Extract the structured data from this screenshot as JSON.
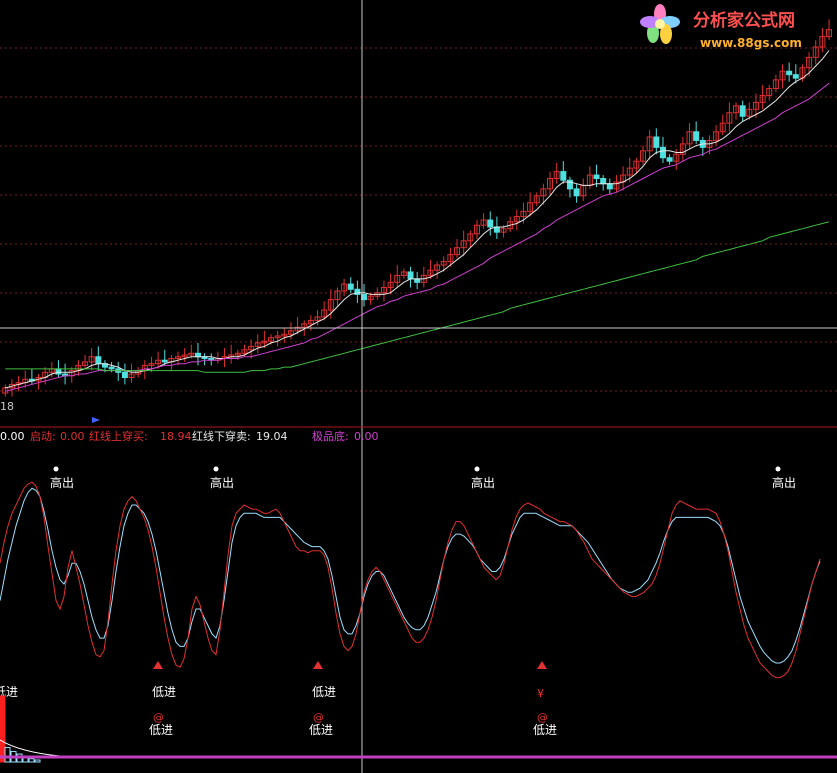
{
  "watermark": {
    "site_name": "分析家公式网",
    "site_url": "www.88gs.com",
    "logo_icon": "flower-logo-icon"
  },
  "colors": {
    "background": "#000000",
    "grid": "#7a1f1f",
    "divider": "#b01818",
    "candle_up": "#e03030",
    "candle_down": "#4fe0e0",
    "ma_white": "#e8e8e8",
    "ma_magenta": "#d040d0",
    "ma_green": "#40c040",
    "crosshair": "#c8c8c8",
    "osc_red": "#e03030",
    "osc_cyan": "#9be0ff",
    "label_white": "#ffffff",
    "label_red": "#e03030",
    "bar_red": "#ff2020",
    "bottom_line": "#c040c0",
    "status_start": "#e03030",
    "status_cross_up": "#e03030",
    "status_cross_down": "#e8e8e8",
    "status_bottom": "#d040d0"
  },
  "price_panel": {
    "corner_label": "18",
    "marker_icon": "arrow-right-icon"
  },
  "status_bar": {
    "lead_value": "0.00",
    "items": [
      {
        "label": "启动:",
        "value": "0.00"
      },
      {
        "label": "红线上穿买:",
        "value": "18.94"
      },
      {
        "label": "红线下穿卖:",
        "value": "19.04"
      },
      {
        "label": "极品底:",
        "value": "0.00"
      }
    ]
  },
  "signals": {
    "high_label": "高出",
    "low_label": "低进",
    "at_symbol": "@",
    "yen_symbol": "¥"
  },
  "chart_data": {
    "type": "line",
    "candles": {
      "x": [
        1,
        2,
        3,
        4,
        5,
        6,
        7,
        8,
        9,
        10,
        11,
        12,
        13,
        14,
        15,
        16,
        17,
        18,
        19,
        20,
        21,
        22,
        23,
        24,
        25,
        26,
        27,
        28,
        29,
        30,
        31,
        32,
        33,
        34,
        35,
        36,
        37,
        38,
        39,
        40,
        41,
        42,
        43,
        44,
        45,
        46,
        47,
        48,
        49,
        50,
        51,
        52,
        53,
        54,
        55,
        56,
        57,
        58,
        59,
        60,
        61,
        62,
        63,
        64,
        65,
        66,
        67,
        68,
        69,
        70,
        71,
        72,
        73,
        74,
        75,
        76,
        77,
        78,
        79,
        80,
        81,
        82,
        83,
        84,
        85,
        86,
        87,
        88,
        89,
        90,
        91,
        92,
        93,
        94,
        95,
        96,
        97,
        98,
        99,
        100,
        101,
        102,
        103,
        104,
        105,
        106,
        107,
        108,
        109,
        110,
        111,
        112,
        113,
        114,
        115,
        116,
        117,
        118,
        119,
        120,
        121,
        122,
        123,
        124,
        125
      ],
      "open": [
        4,
        7,
        9,
        10,
        12,
        11,
        13,
        16,
        18,
        15,
        14,
        17,
        20,
        22,
        25,
        21,
        19,
        18,
        16,
        13,
        15,
        17,
        20,
        21,
        23,
        22,
        24,
        25,
        26,
        27,
        25,
        24,
        23,
        24,
        25,
        26,
        27,
        29,
        31,
        33,
        34,
        36,
        37,
        38,
        40,
        42,
        44,
        46,
        48,
        52,
        58,
        63,
        67,
        64,
        61,
        58,
        60,
        62,
        65,
        68,
        72,
        74,
        70,
        68,
        72,
        75,
        78,
        80,
        84,
        88,
        92,
        96,
        101,
        104,
        100,
        97,
        99,
        103,
        106,
        109,
        114,
        118,
        122,
        128,
        132,
        127,
        122,
        118,
        124,
        130,
        128,
        125,
        122,
        126,
        130,
        134,
        138,
        144,
        152,
        146,
        140,
        138,
        142,
        148,
        155,
        150,
        146,
        150,
        155,
        160,
        166,
        170,
        164,
        168,
        172,
        176,
        180,
        185,
        190,
        188,
        186,
        192,
        198,
        204,
        210
      ],
      "close": [
        7,
        9,
        10,
        12,
        11,
        13,
        16,
        18,
        15,
        14,
        17,
        20,
        22,
        25,
        21,
        19,
        18,
        16,
        13,
        15,
        17,
        20,
        21,
        23,
        22,
        24,
        25,
        26,
        27,
        25,
        24,
        23,
        24,
        25,
        26,
        27,
        29,
        31,
        33,
        34,
        36,
        37,
        38,
        40,
        42,
        44,
        46,
        48,
        52,
        58,
        63,
        67,
        64,
        61,
        58,
        60,
        62,
        65,
        68,
        72,
        74,
        70,
        68,
        72,
        75,
        78,
        80,
        84,
        88,
        92,
        96,
        101,
        104,
        100,
        97,
        99,
        103,
        106,
        109,
        114,
        118,
        122,
        128,
        132,
        127,
        122,
        118,
        124,
        130,
        128,
        125,
        122,
        126,
        130,
        134,
        138,
        144,
        152,
        146,
        140,
        138,
        142,
        148,
        155,
        150,
        146,
        150,
        155,
        160,
        166,
        170,
        164,
        168,
        172,
        176,
        180,
        185,
        190,
        188,
        186,
        192,
        198,
        204,
        210,
        214
      ]
    },
    "series": [
      {
        "values": [
          7,
          8,
          9,
          10,
          11,
          12,
          13,
          15,
          16,
          16,
          16,
          17,
          18,
          20,
          21,
          21,
          20,
          19,
          17,
          16,
          16,
          17,
          18,
          19,
          21,
          22,
          23,
          24,
          25,
          25,
          25,
          25,
          24,
          24,
          25,
          25,
          26,
          28,
          30,
          31,
          33,
          34,
          36,
          37,
          39,
          41,
          43,
          45,
          47,
          50,
          54,
          58,
          61,
          62,
          62,
          61,
          61,
          61,
          62,
          65,
          68,
          70,
          70,
          70,
          71,
          73,
          75,
          78,
          81,
          84,
          88,
          92,
          96,
          99,
          100,
          100,
          101,
          102,
          104,
          107,
          110,
          114,
          118,
          123,
          126,
          126,
          125,
          124,
          124,
          125,
          125,
          125,
          125,
          126,
          128,
          131,
          135,
          140,
          143,
          144,
          144,
          143,
          143,
          145,
          147,
          148,
          148,
          149,
          151,
          154,
          158,
          161,
          163,
          165,
          167,
          170,
          173,
          177,
          181,
          184,
          186,
          189,
          193,
          197,
          202
        ]
      },
      {
        "values": [
          5,
          6,
          7,
          8,
          9,
          10,
          11,
          12,
          13,
          14,
          14,
          15,
          15,
          16,
          17,
          17,
          17,
          17,
          17,
          17,
          17,
          18,
          18,
          19,
          20,
          20,
          21,
          21,
          22,
          22,
          23,
          23,
          23,
          24,
          24,
          24,
          25,
          25,
          26,
          27,
          28,
          29,
          30,
          31,
          32,
          33,
          35,
          36,
          38,
          40,
          42,
          44,
          46,
          48,
          50,
          52,
          54,
          55,
          57,
          58,
          60,
          61,
          62,
          63,
          64,
          66,
          67,
          69,
          71,
          73,
          75,
          77,
          79,
          82,
          84,
          86,
          88,
          90,
          92,
          94,
          96,
          99,
          101,
          104,
          106,
          108,
          110,
          112,
          114,
          116,
          118,
          119,
          120,
          122,
          124,
          126,
          128,
          130,
          132,
          134,
          135,
          136,
          138,
          140,
          141,
          142,
          144,
          145,
          147,
          149,
          151,
          153,
          155,
          157,
          159,
          161,
          163,
          166,
          168,
          170,
          172,
          174,
          177,
          180,
          183
        ]
      },
      {
        "values": [
          18,
          18,
          18,
          18,
          18,
          18,
          18,
          18,
          18,
          18,
          18,
          18,
          18,
          18,
          18,
          17,
          17,
          17,
          17,
          17,
          17,
          17,
          17,
          17,
          17,
          17,
          17,
          17,
          17,
          17,
          16,
          16,
          16,
          16,
          16,
          16,
          16,
          17,
          17,
          17,
          18,
          18,
          19,
          19,
          20,
          21,
          22,
          23,
          24,
          25,
          26,
          27,
          28,
          29,
          30,
          31,
          32,
          33,
          34,
          35,
          36,
          37,
          38,
          39,
          40,
          41,
          42,
          43,
          44,
          45,
          46,
          47,
          48,
          49,
          50,
          51,
          53,
          54,
          55,
          56,
          57,
          58,
          59,
          60,
          61,
          62,
          63,
          64,
          65,
          66,
          67,
          68,
          69,
          70,
          71,
          72,
          73,
          74,
          75,
          76,
          77,
          78,
          79,
          80,
          81,
          83,
          84,
          85,
          86,
          87,
          88,
          89,
          90,
          91,
          92,
          94,
          95,
          96,
          97,
          98,
          99,
          100,
          101,
          102,
          103
        ]
      }
    ],
    "oscillator": {
      "x": [
        0,
        4,
        8,
        12,
        16,
        20,
        24,
        28,
        32,
        36,
        40,
        44,
        48,
        52,
        56,
        60,
        64,
        68,
        72,
        76,
        80,
        84,
        88,
        92,
        96,
        100,
        104,
        108,
        112,
        116,
        120,
        124,
        128,
        132,
        136,
        140,
        144,
        148,
        152,
        156,
        160,
        164,
        168,
        172,
        176,
        180,
        184,
        188,
        192,
        196,
        200,
        204,
        208,
        212,
        216,
        220,
        224,
        228,
        232,
        236,
        240,
        244,
        248,
        252,
        256,
        260,
        264,
        268,
        272,
        276,
        280,
        284,
        288,
        292,
        296,
        300,
        304,
        308,
        312,
        316,
        320,
        324,
        328,
        332,
        336,
        340,
        344,
        348,
        352,
        356,
        360,
        364,
        368,
        372,
        376,
        380,
        384,
        388,
        392,
        396,
        400,
        404,
        408,
        412,
        416,
        420,
        424,
        428,
        432,
        436,
        440,
        444,
        448,
        452,
        456,
        460,
        464,
        468,
        472,
        476,
        480,
        484,
        488,
        492,
        496,
        500,
        504,
        508,
        512,
        516,
        520,
        524,
        528,
        532,
        536,
        540,
        544,
        548,
        552,
        556,
        560,
        564,
        568,
        572,
        576,
        580,
        584,
        588,
        592,
        596,
        600,
        604,
        608,
        612,
        616,
        620,
        624,
        628,
        632,
        636,
        640,
        644,
        648,
        652,
        656,
        660,
        664,
        668,
        672,
        676,
        680,
        684,
        688,
        692,
        696,
        700,
        704,
        708,
        712,
        716,
        720,
        724,
        728,
        732,
        736,
        740,
        744,
        748,
        752,
        756,
        760,
        764,
        768,
        772,
        776,
        780,
        784,
        788,
        792,
        796,
        800,
        804,
        808,
        812,
        816,
        820,
        824,
        828,
        832,
        836
      ],
      "red": [
        60,
        70,
        78,
        84,
        88,
        92,
        96,
        98,
        99,
        97,
        92,
        82,
        68,
        55,
        42,
        38,
        44,
        58,
        66,
        58,
        50,
        40,
        30,
        22,
        16,
        15,
        18,
        32,
        50,
        66,
        78,
        86,
        90,
        92,
        90,
        86,
        82,
        76,
        68,
        58,
        46,
        34,
        24,
        16,
        11,
        10,
        14,
        24,
        38,
        44,
        40,
        32,
        24,
        18,
        16,
        28,
        46,
        64,
        78,
        84,
        86,
        88,
        87,
        86,
        86,
        85,
        84,
        84,
        85,
        86,
        84,
        80,
        76,
        72,
        68,
        66,
        66,
        65,
        66,
        66,
        66,
        64,
        58,
        48,
        36,
        26,
        20,
        18,
        20,
        26,
        36,
        46,
        52,
        56,
        58,
        56,
        52,
        48,
        44,
        40,
        36,
        32,
        28,
        24,
        22,
        22,
        24,
        28,
        34,
        42,
        52,
        62,
        70,
        76,
        80,
        80,
        78,
        74,
        70,
        66,
        62,
        58,
        56,
        54,
        52,
        54,
        60,
        68,
        76,
        82,
        86,
        88,
        89,
        88,
        87,
        86,
        84,
        83,
        82,
        81,
        80,
        80,
        79,
        78,
        76,
        73,
        70,
        66,
        62,
        60,
        58,
        56,
        54,
        52,
        50,
        48,
        46,
        45,
        44,
        44,
        45,
        46,
        48,
        50,
        54,
        60,
        68,
        76,
        84,
        88,
        90,
        89,
        88,
        87,
        86,
        86,
        86,
        86,
        85,
        84,
        80,
        74,
        66,
        56,
        46,
        38,
        30,
        24,
        20,
        16,
        12,
        10,
        8,
        6,
        5,
        5,
        6,
        8,
        12,
        18,
        26,
        34,
        42,
        50,
        56,
        62
      ],
      "cyan": [
        42,
        52,
        62,
        70,
        78,
        84,
        90,
        94,
        96,
        95,
        92,
        85,
        76,
        66,
        58,
        52,
        50,
        54,
        60,
        60,
        56,
        50,
        42,
        34,
        28,
        24,
        24,
        30,
        42,
        56,
        68,
        78,
        84,
        88,
        88,
        86,
        84,
        80,
        74,
        66,
        56,
        46,
        36,
        28,
        22,
        20,
        20,
        24,
        32,
        38,
        38,
        34,
        30,
        26,
        24,
        30,
        42,
        56,
        70,
        78,
        82,
        84,
        84,
        84,
        84,
        83,
        82,
        82,
        82,
        82,
        82,
        80,
        78,
        76,
        74,
        72,
        70,
        69,
        68,
        68,
        68,
        66,
        62,
        54,
        44,
        34,
        28,
        26,
        26,
        30,
        36,
        44,
        50,
        54,
        56,
        56,
        54,
        50,
        46,
        42,
        38,
        34,
        31,
        29,
        28,
        28,
        30,
        34,
        40,
        46,
        54,
        62,
        68,
        72,
        74,
        74,
        73,
        71,
        69,
        66,
        62,
        60,
        58,
        56,
        56,
        58,
        62,
        68,
        74,
        78,
        82,
        84,
        84,
        84,
        84,
        83,
        82,
        81,
        80,
        79,
        78,
        78,
        78,
        78,
        76,
        74,
        72,
        70,
        67,
        64,
        61,
        58,
        55,
        52,
        50,
        48,
        47,
        46,
        46,
        47,
        48,
        50,
        52,
        56,
        60,
        65,
        71,
        76,
        80,
        82,
        82,
        82,
        82,
        82,
        82,
        82,
        82,
        82,
        81,
        80,
        78,
        74,
        68,
        60,
        52,
        44,
        38,
        32,
        28,
        24,
        20,
        17,
        15,
        13,
        12,
        12,
        13,
        15,
        18,
        23,
        29,
        36,
        43,
        50,
        56,
        61
      ]
    },
    "high_signals_x": [
      62,
      222,
      483,
      784
    ],
    "low_signals_x": [
      0,
      158,
      318
    ],
    "low_marker_signals_x": [
      158,
      318,
      542
    ],
    "bottom_bars": [
      {
        "x": 2,
        "value": 1.0
      },
      {
        "x": 8,
        "value": 0.22
      },
      {
        "x": 14,
        "value": 0.16
      },
      {
        "x": 20,
        "value": 0.12
      },
      {
        "x": 26,
        "value": 0.08
      },
      {
        "x": 32,
        "value": 0.05
      },
      {
        "x": 38,
        "value": 0.03
      }
    ],
    "crosshair": {
      "x": 362,
      "price_level": 0.08
    },
    "grid": true
  }
}
